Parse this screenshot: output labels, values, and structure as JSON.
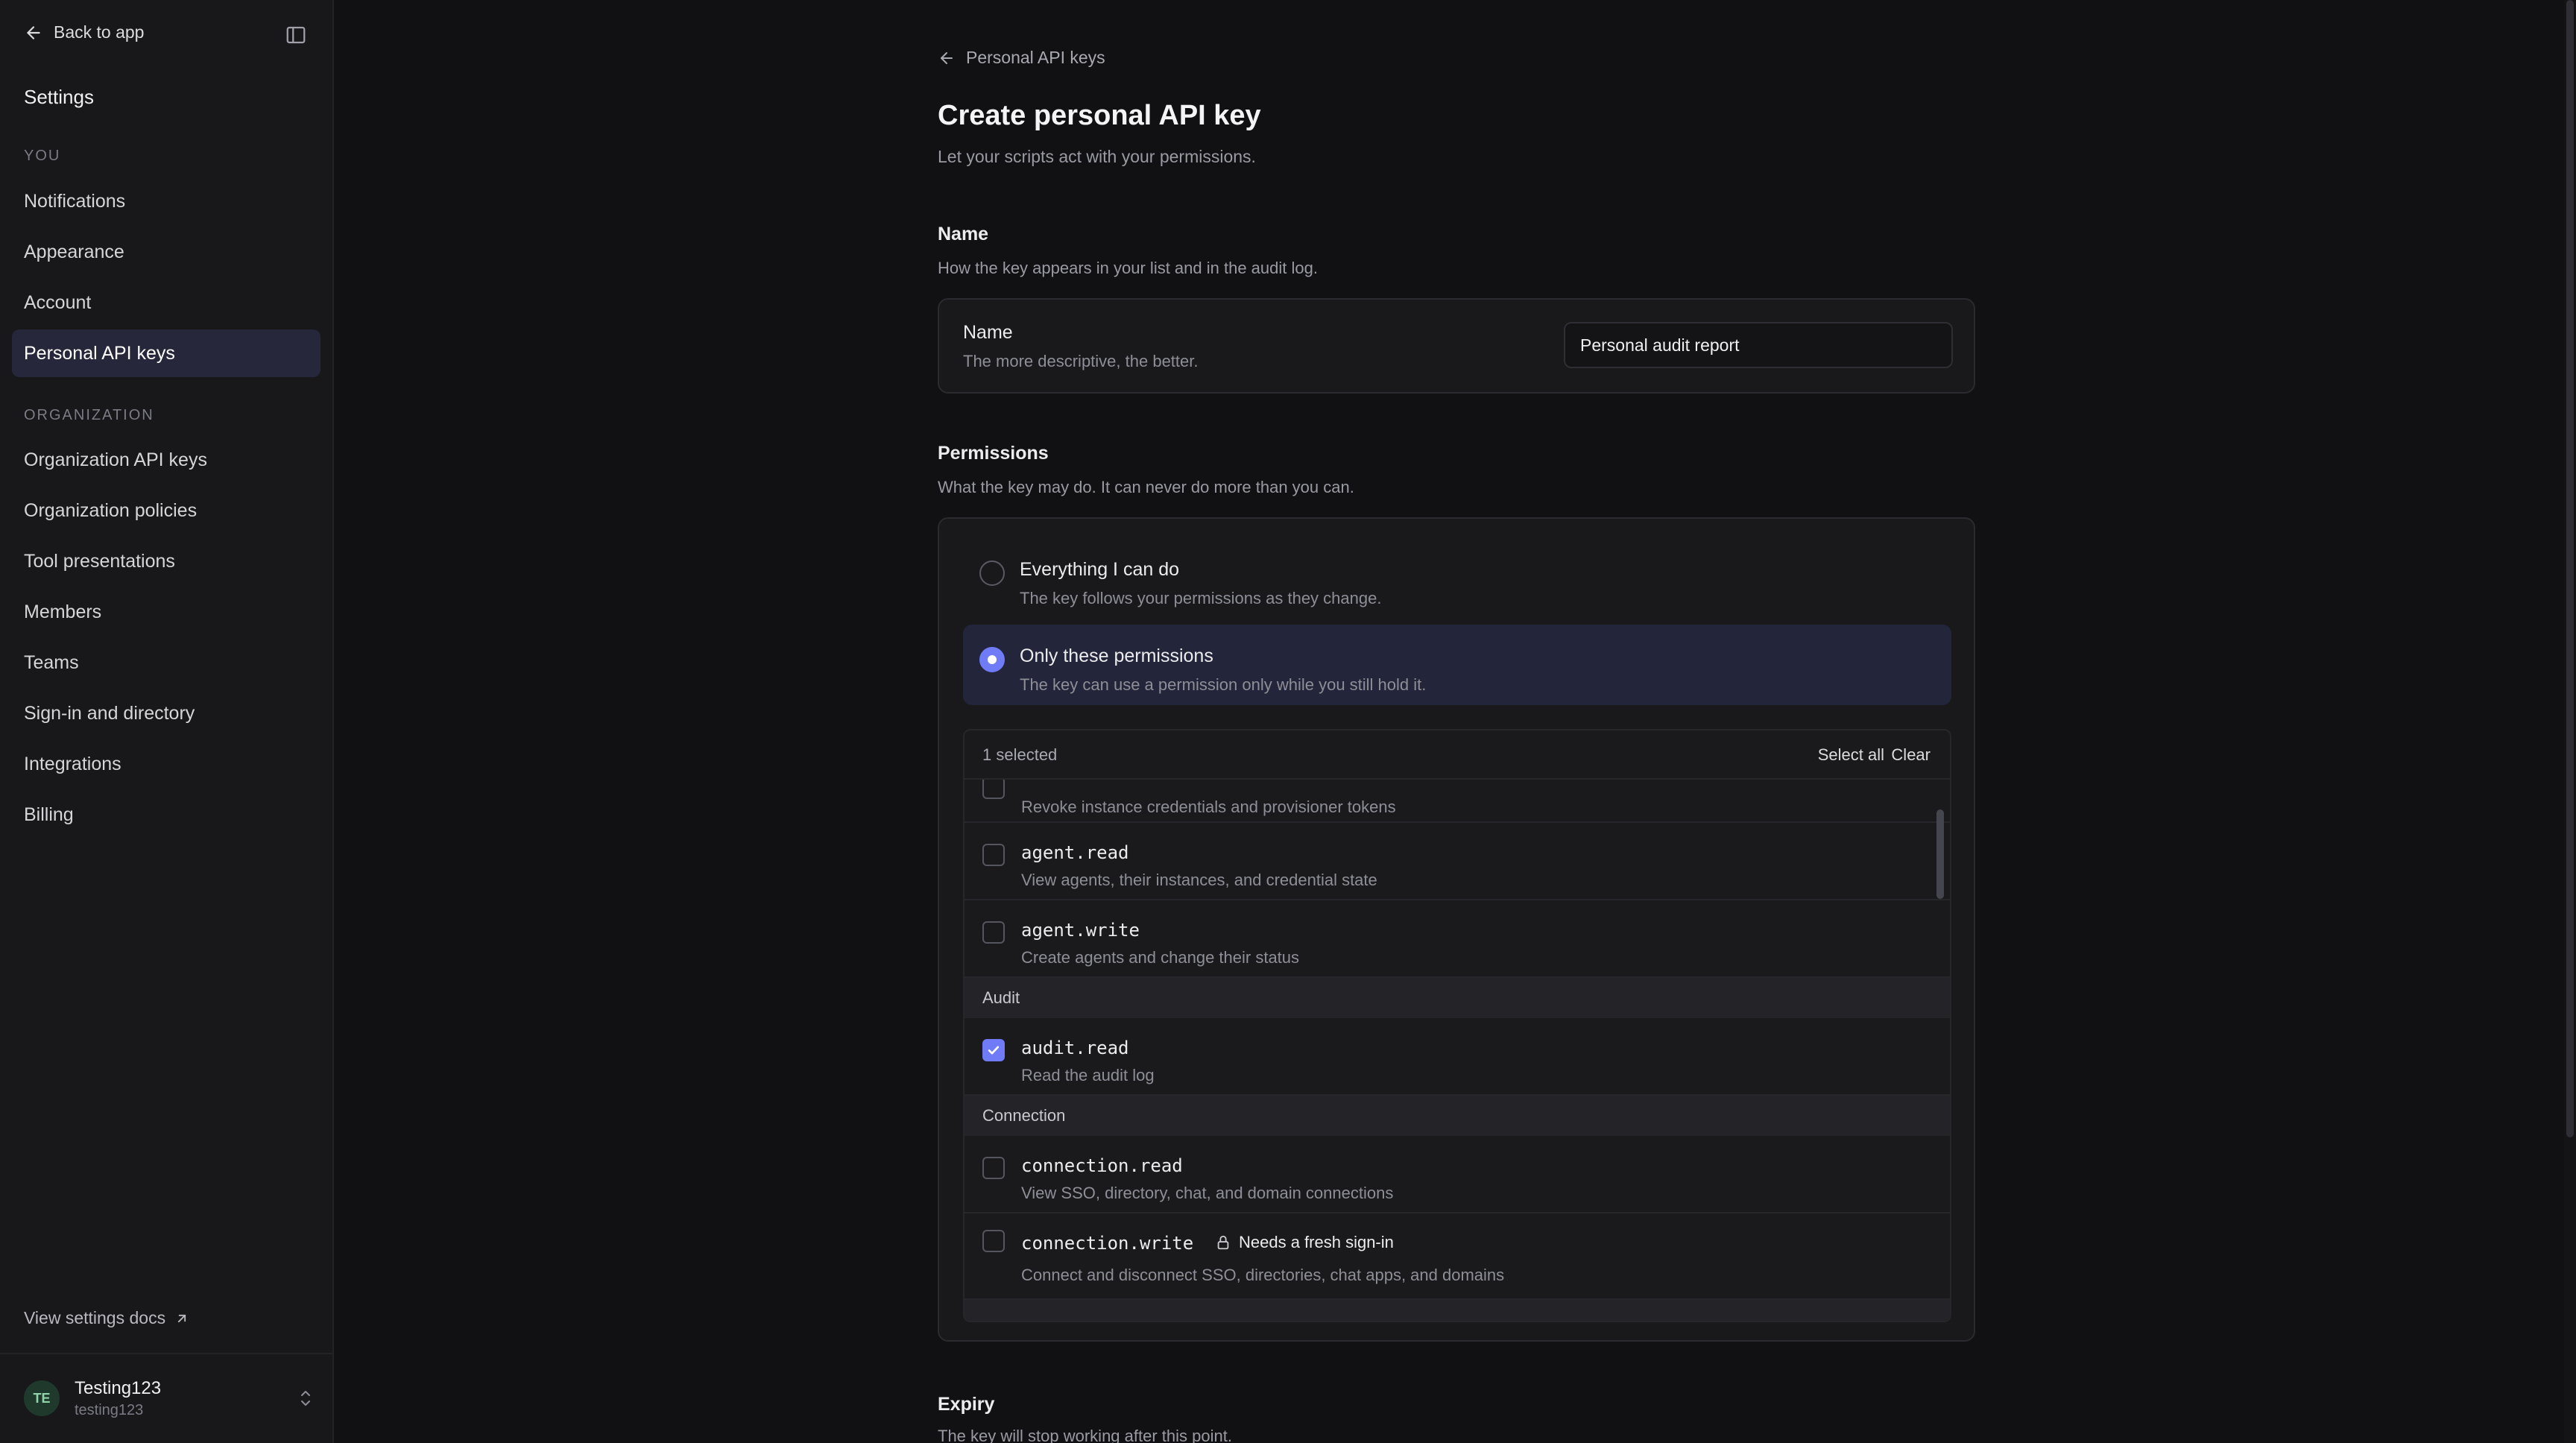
{
  "sidebar": {
    "back_label": "Back to app",
    "title": "Settings",
    "section_you": "YOU",
    "you_items": [
      {
        "label": "Notifications"
      },
      {
        "label": "Appearance"
      },
      {
        "label": "Account"
      },
      {
        "label": "Personal API keys"
      }
    ],
    "section_org": "ORGANIZATION",
    "org_items": [
      {
        "label": "Organization API keys"
      },
      {
        "label": "Organization policies"
      },
      {
        "label": "Tool presentations"
      },
      {
        "label": "Members"
      },
      {
        "label": "Teams"
      },
      {
        "label": "Sign-in and directory"
      },
      {
        "label": "Integrations"
      },
      {
        "label": "Billing"
      }
    ],
    "docs_link": "View settings docs",
    "user": {
      "initials": "TE",
      "name": "Testing123",
      "handle": "testing123"
    }
  },
  "main": {
    "breadcrumb": "Personal API keys",
    "title": "Create personal API key",
    "subtitle": "Let your scripts act with your permissions.",
    "name_section": {
      "title": "Name",
      "description": "How the key appears in your list and in the audit log.",
      "field_label": "Name",
      "field_hint": "The more descriptive, the better.",
      "value": "Personal audit report"
    },
    "permissions_section": {
      "title": "Permissions",
      "description": "What the key may do. It can never do more than you can.",
      "options": [
        {
          "title": "Everything I can do",
          "description": "The key follows your permissions as they change.",
          "selected": false
        },
        {
          "title": "Only these permissions",
          "description": "The key can use a permission only while you still hold it.",
          "selected": true
        }
      ],
      "list": {
        "selected_count": "1 selected",
        "select_all": "Select all",
        "clear": "Clear",
        "partial_row_desc": "Revoke instance credentials and provisioner tokens",
        "rows": [
          {
            "name": "agent.read",
            "description": "View agents, their instances, and credential state",
            "checked": false
          },
          {
            "name": "agent.write",
            "description": "Create agents and change their status",
            "checked": false
          }
        ],
        "group_audit": "Audit",
        "audit_rows": [
          {
            "name": "audit.read",
            "description": "Read the audit log",
            "checked": true
          }
        ],
        "group_connection": "Connection",
        "connection_rows": [
          {
            "name": "connection.read",
            "description": "View SSO, directory, chat, and domain connections",
            "checked": false
          },
          {
            "name": "connection.write",
            "description": "Connect and disconnect SSO, directories, chat apps, and domains",
            "checked": false,
            "badge": "Needs a fresh sign-in"
          }
        ]
      }
    },
    "expiry_section": {
      "title": "Expiry",
      "description": "The key will stop working after this point."
    }
  },
  "colors": {
    "accent": "#6f7bf7",
    "background": "#111113",
    "sidebar": "#18181b"
  }
}
